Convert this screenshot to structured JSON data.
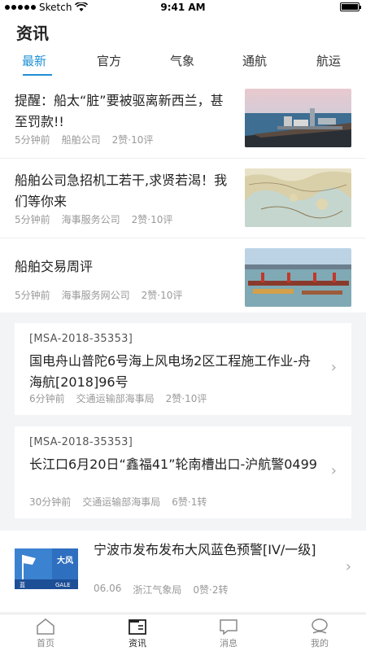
{
  "status_bar": {
    "carrier": "Sketch",
    "time": "9:41 AM"
  },
  "header": {
    "title": "资讯"
  },
  "tabs": [
    {
      "label": "最新",
      "active": true
    },
    {
      "label": "官方",
      "active": false
    },
    {
      "label": "气象",
      "active": false
    },
    {
      "label": "通航",
      "active": false
    },
    {
      "label": "航运",
      "active": false
    }
  ],
  "news": [
    {
      "title": "提醒：船太“脏”要被驱离新西兰，甚至罚款!!",
      "time": "5分钟前",
      "source": "船舶公司",
      "stats": "2赞·10评"
    },
    {
      "title": " 船舶公司急招机工若干,求贤若渴！我们等你来",
      "time": "5分钟前",
      "source": "海事服务公司",
      "stats": "2赞·10评"
    },
    {
      "title": "船舶交易周评",
      "time": "5分钟前",
      "source": "海事服务网公司",
      "stats": "2赞·10评"
    }
  ],
  "notices": [
    {
      "code": "[MSA-2018-35353]",
      "title": "国电舟山普陀6号海上风电场2区工程施工作业-舟海航[2018]96号",
      "time": "6分钟前",
      "source": "交通运输部海事局",
      "stats": "2赞·10评"
    },
    {
      "code": "[MSA-2018-35353]",
      "title": "长江口6月20日“鑫福41”轮南槽出口-沪航警0499",
      "time": "30分钟前",
      "source": "交通运输部海事局",
      "stats": "6赞·1转"
    }
  ],
  "warning": {
    "title": "宁波市发布发布大风蓝色预警[IV/一级]",
    "date": "06.06",
    "source": "浙江气象局",
    "stats": "0赞·2转",
    "icon_text_top": "大风",
    "icon_text_bottom": "GALE",
    "icon_text_left": "蓝"
  },
  "bottom_nav": [
    {
      "label": "首页",
      "icon": "home-icon",
      "active": false
    },
    {
      "label": "资讯",
      "icon": "news-icon",
      "active": true
    },
    {
      "label": "消息",
      "icon": "message-icon",
      "active": false
    },
    {
      "label": "我的",
      "icon": "profile-icon",
      "active": false
    }
  ],
  "colors": {
    "accent": "#1e90d6",
    "meta": "#999999",
    "background_gray": "#f3f4f6"
  }
}
